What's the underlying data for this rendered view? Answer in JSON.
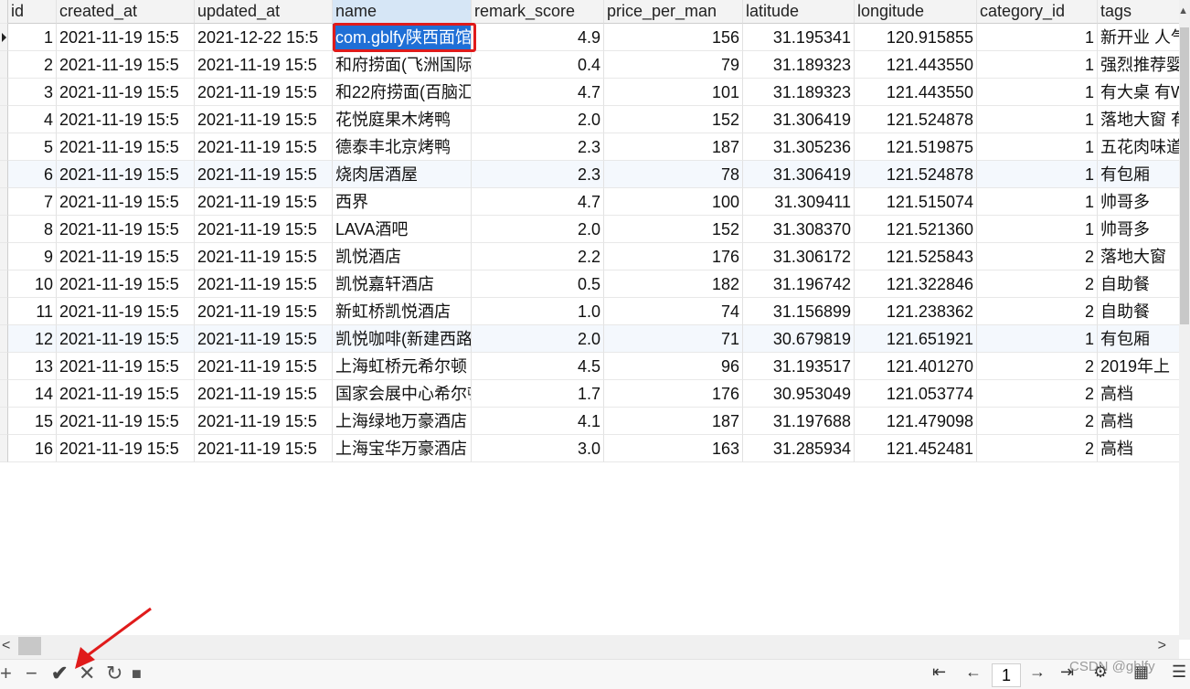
{
  "columns": [
    "id",
    "created_at",
    "updated_at",
    "name",
    "remark_score",
    "price_per_man",
    "latitude",
    "longitude",
    "category_id",
    "tags"
  ],
  "rows": [
    [
      "1",
      "2021-11-19 15:5",
      "2021-12-22 15:5",
      "com.gblfy陕西面馆",
      "4.9",
      "156",
      "31.195341",
      "120.915855",
      "1",
      "新开业 人气"
    ],
    [
      "2",
      "2021-11-19 15:5",
      "2021-11-19 15:5",
      "和府捞面(飞洲国际",
      "0.4",
      "79",
      "31.189323",
      "121.443550",
      "1",
      "强烈推荐婴"
    ],
    [
      "3",
      "2021-11-19 15:5",
      "2021-11-19 15:5",
      "和22府捞面(百脑汇",
      "4.7",
      "101",
      "31.189323",
      "121.443550",
      "1",
      "有大桌 有W"
    ],
    [
      "4",
      "2021-11-19 15:5",
      "2021-11-19 15:5",
      "花悦庭果木烤鸭",
      "2.0",
      "152",
      "31.306419",
      "121.524878",
      "1",
      "落地大窗 有"
    ],
    [
      "5",
      "2021-11-19 15:5",
      "2021-11-19 15:5",
      "德泰丰北京烤鸭",
      "2.3",
      "187",
      "31.305236",
      "121.519875",
      "1",
      "五花肉味道"
    ],
    [
      "6",
      "2021-11-19 15:5",
      "2021-11-19 15:5",
      "烧肉居酒屋",
      "2.3",
      "78",
      "31.306419",
      "121.524878",
      "1",
      "有包厢"
    ],
    [
      "7",
      "2021-11-19 15:5",
      "2021-11-19 15:5",
      "西界",
      "4.7",
      "100",
      "31.309411",
      "121.515074",
      "1",
      "帅哥多"
    ],
    [
      "8",
      "2021-11-19 15:5",
      "2021-11-19 15:5",
      "LAVA酒吧",
      "2.0",
      "152",
      "31.308370",
      "121.521360",
      "1",
      "帅哥多"
    ],
    [
      "9",
      "2021-11-19 15:5",
      "2021-11-19 15:5",
      "凯悦酒店",
      "2.2",
      "176",
      "31.306172",
      "121.525843",
      "2",
      "落地大窗"
    ],
    [
      "10",
      "2021-11-19 15:5",
      "2021-11-19 15:5",
      "凯悦嘉轩酒店",
      "0.5",
      "182",
      "31.196742",
      "121.322846",
      "2",
      "自助餐"
    ],
    [
      "11",
      "2021-11-19 15:5",
      "2021-11-19 15:5",
      "新虹桥凯悦酒店",
      "1.0",
      "74",
      "31.156899",
      "121.238362",
      "2",
      "自助餐"
    ],
    [
      "12",
      "2021-11-19 15:5",
      "2021-11-19 15:5",
      "凯悦咖啡(新建西路",
      "2.0",
      "71",
      "30.679819",
      "121.651921",
      "1",
      "有包厢"
    ],
    [
      "13",
      "2021-11-19 15:5",
      "2021-11-19 15:5",
      "上海虹桥元希尔顿",
      "4.5",
      "96",
      "31.193517",
      "121.401270",
      "2",
      "2019年上"
    ],
    [
      "14",
      "2021-11-19 15:5",
      "2021-11-19 15:5",
      "国家会展中心希尔顿",
      "1.7",
      "176",
      "30.953049",
      "121.053774",
      "2",
      "高档"
    ],
    [
      "15",
      "2021-11-19 15:5",
      "2021-11-19 15:5",
      "上海绿地万豪酒店",
      "4.1",
      "187",
      "31.197688",
      "121.479098",
      "2",
      "高档"
    ],
    [
      "16",
      "2021-11-19 15:5",
      "2021-11-19 15:5",
      "上海宝华万豪酒店",
      "3.0",
      "163",
      "31.285934",
      "121.452481",
      "2",
      "高档"
    ]
  ],
  "pagination": {
    "page": "1"
  },
  "watermark": "CSDN @gblfy",
  "colors": {
    "selection": "#1f6fd6",
    "highlight_border": "#e01b1b",
    "arrow": "#e01b1b"
  },
  "toolbar_icons": [
    "add-icon",
    "remove-icon",
    "apply-check-icon",
    "cancel-icon",
    "refresh-icon",
    "stop-icon"
  ],
  "nav_icons": [
    "first-page-icon",
    "prev-page-icon",
    "next-page-icon",
    "last-page-icon",
    "settings-icon",
    "grid-view-icon",
    "form-view-icon"
  ]
}
